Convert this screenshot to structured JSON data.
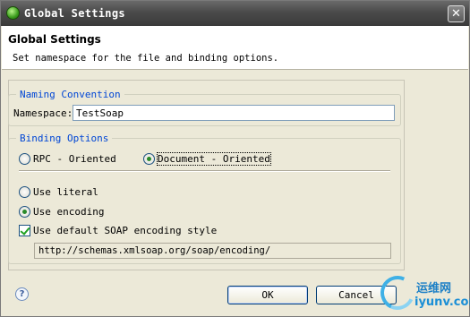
{
  "window": {
    "title": "Global Settings",
    "close_glyph": "✕"
  },
  "header": {
    "title": "Global Settings",
    "description": "Set namespace for the file and binding options."
  },
  "naming": {
    "legend": "Naming Convention",
    "namespace_label": "Namespace:",
    "namespace_value": "TestSoap"
  },
  "binding": {
    "legend": "Binding Options",
    "style_options": [
      {
        "label": "RPC - Oriented",
        "checked": false
      },
      {
        "label": "Document - Oriented",
        "checked": true
      }
    ],
    "use_options": [
      {
        "label": "Use literal",
        "checked": false
      },
      {
        "label": "Use encoding",
        "checked": true
      }
    ],
    "default_encoding": {
      "label": "Use default SOAP encoding style",
      "checked": true
    },
    "encoding_url": "http://schemas.xmlsoap.org/soap/encoding/"
  },
  "footer": {
    "help_glyph": "?",
    "ok_label": "OK",
    "cancel_label": "Cancel"
  },
  "watermark": {
    "top_text": "运维网",
    "bottom_text": "iyunv.com"
  },
  "colors": {
    "legend_text": "#0046d5",
    "title_bar": "#4a4a4a",
    "check_mark": "#21a121"
  }
}
